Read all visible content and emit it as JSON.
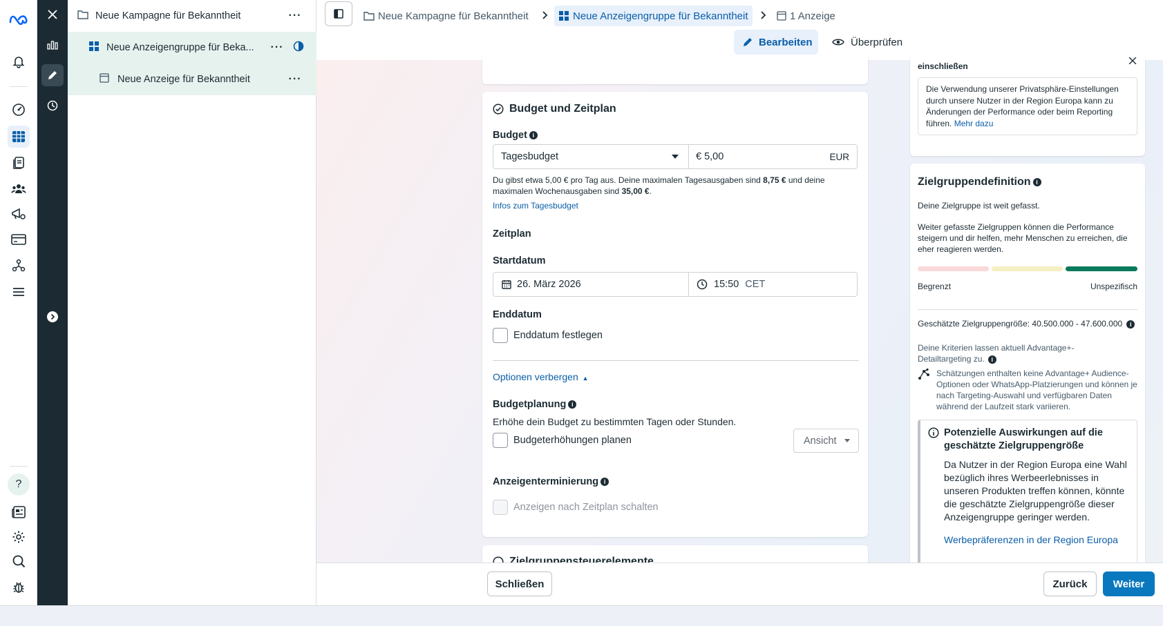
{
  "tree": {
    "campaign": "Neue Kampagne für Bekanntheit",
    "adset": "Neue Anzeigengruppe für Beka...",
    "ad": "Neue Anzeige für Bekanntheit"
  },
  "breadcrumb": {
    "campaign": "Neue Kampagne für Bekanntheit",
    "adset": "Neue Anzeigengruppe für Bekanntheit",
    "ads": "1 Anzeige"
  },
  "toolbar": {
    "edit": "Bearbeiten",
    "review": "Überprüfen"
  },
  "budget_section": {
    "title": "Budget und Zeitplan",
    "budget_label": "Budget",
    "budget_type": "Tagesbudget",
    "amount": "€ 5,00",
    "currency": "EUR",
    "desc_1": "Du gibst etwa 5,00 € pro Tag aus. Deine maximalen Tagesausgaben sind ",
    "desc_max_day": "8,75 €",
    "desc_2": " und deine maximalen Wochenausgaben sind ",
    "desc_max_week": "35,00 €",
    "desc_3": ".",
    "info_link": "Infos zum Tagesbudget",
    "schedule_label": "Zeitplan",
    "start_label": "Startdatum",
    "start_date": "26. März 2026",
    "start_time": "15:50",
    "timezone": "CET",
    "end_label": "Enddatum",
    "end_checkbox": "Enddatum festlegen",
    "hide_options": "Optionen verbergen",
    "planning_label": "Budgetplanung",
    "planning_desc": "Erhöhe dein Budget zu bestimmten Tagen oder Stunden.",
    "planning_checkbox": "Budgeterhöhungen planen",
    "view_select": "Ansicht",
    "terminierung_label": "Anzeigenterminierung",
    "terminierung_checkbox": "Anzeigen nach Zeitplan schalten"
  },
  "next_section_partial": "Zielgruppensteuerelemente",
  "privacy_card": {
    "title": "einschließen",
    "text": "Die Verwendung unserer Privatsphäre-Einstellungen durch unsere Nutzer in der Region Europa kann zu Änderungen der Performance oder beim Reporting führen.",
    "link": "Mehr dazu"
  },
  "audience_card": {
    "title": "Zielgruppendefinition",
    "subtitle": "Deine Zielgruppe ist weit gefasst.",
    "desc": "Weiter gefasste Zielgruppen können die Performance steigern und dir helfen, mehr Menschen zu erreichen, die eher reagieren werden.",
    "left_label": "Begrenzt",
    "right_label": "Unspezifisch",
    "size_text": "Geschätzte Zielgruppengröße: 40.500.000 - 47.600.000",
    "criteria_text": "Deine Kriterien lassen aktuell Advantage+-Detailtargeting zu.",
    "estimate_text": "Schätzungen enthalten keine Advantage+ Audience-Optionen oder WhatsApp-Platzierungen und können je nach Targeting-Auswahl und verfügbaren Daten während der Laufzeit stark variieren.",
    "impact_title": "Potenzielle Auswirkungen auf die geschätzte Zielgruppengröße",
    "impact_text": "Da Nutzer in der Region Europa eine Wahl bezüglich ihres Werbeerlebnisses in unseren Produkten treffen können, könnte die geschätzte Zielgruppengröße dieser Anzeigengruppe geringer werden.",
    "impact_link": "Werbepräferenzen in der Region Europa"
  },
  "buttons": {
    "close": "Schließen",
    "back": "Zurück",
    "next": "Weiter"
  },
  "colors": {
    "brand_blue": "#0a78be",
    "link_blue": "#0a5ea8",
    "meter_green": "#0a7a5a",
    "meter_pink": "#f9d9d9",
    "meter_yellow": "#f5efc4"
  },
  "audience_meter_level": 0.85
}
